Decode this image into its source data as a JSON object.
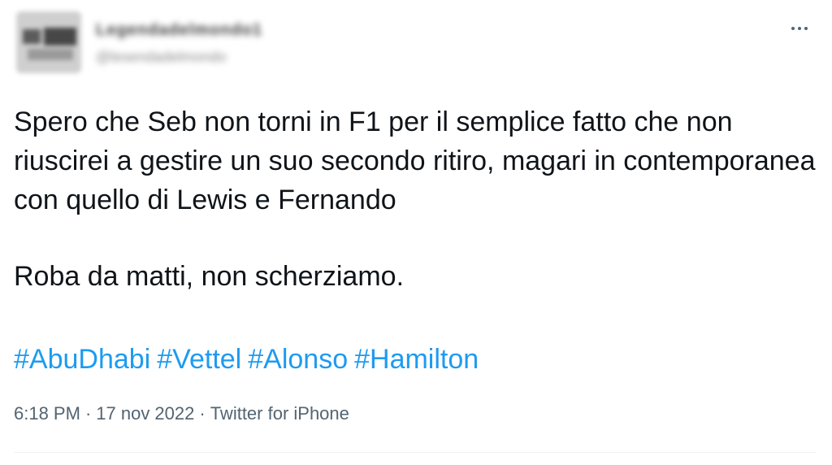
{
  "author": {
    "display_name": "Legendadelmondo1",
    "handle": "@lesendadelmondo"
  },
  "menu": {
    "icon": "more-horizontal-icon"
  },
  "tweet": {
    "paragraph_1": "Spero che Seb non torni in F1 per il semplice fatto che non riuscirei a gestire un suo secondo ritiro, magari in contemporanea con quello di Lewis e Fernando",
    "paragraph_2": "Roba da matti, non scherziamo.",
    "hashtags": [
      "#AbuDhabi",
      "#Vettel",
      "#Alonso",
      "#Hamilton"
    ],
    "time": "6:18 PM",
    "date": "17 nov 2022",
    "source": "Twitter for iPhone",
    "separator": "·"
  },
  "colors": {
    "link": "#1d9bf0",
    "text": "#0f1419",
    "muted": "#536471"
  }
}
